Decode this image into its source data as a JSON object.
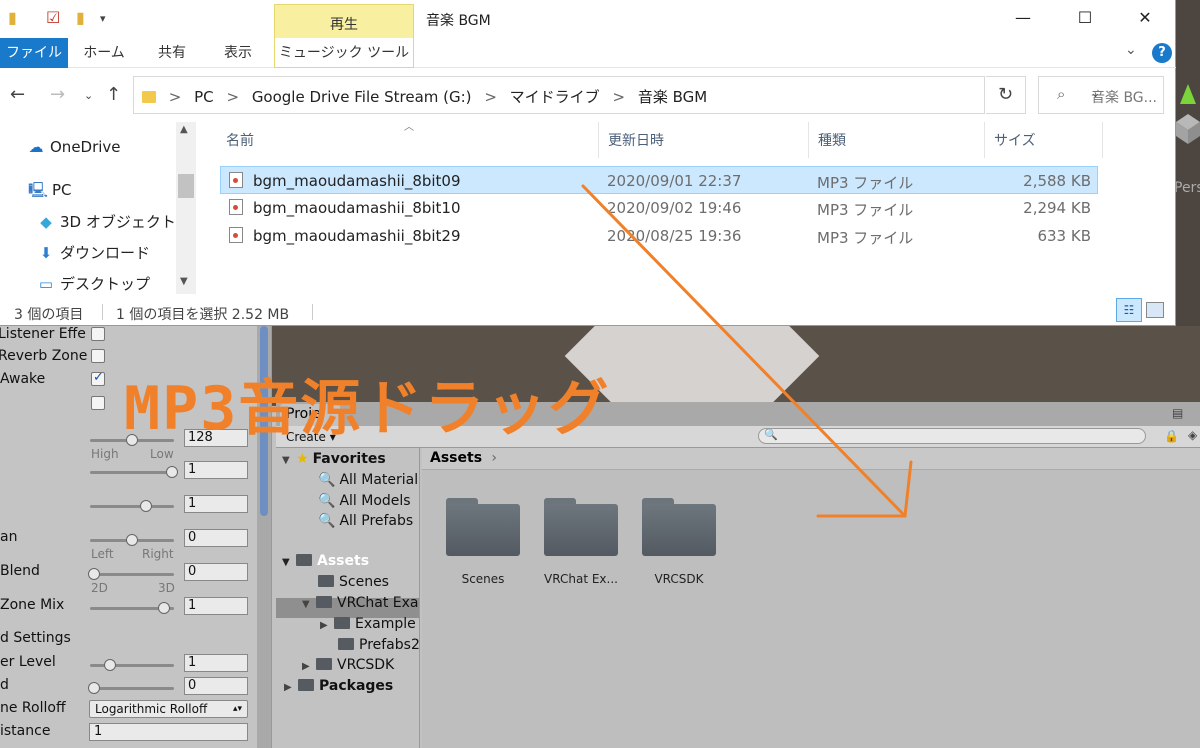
{
  "explorer": {
    "window_title": "音楽 BGM",
    "context_tab_group": "再生",
    "ribbon_tabs": {
      "file": "ファイル",
      "home": "ホーム",
      "share": "共有",
      "view": "表示",
      "music_tools": "ミュージック ツール"
    },
    "help": "?",
    "address": {
      "crumbs": [
        "PC",
        "Google Drive File Stream (G:)",
        "マイドライブ",
        "音楽 BGM"
      ],
      "separator": ">"
    },
    "search_placeholder": "音楽 BG...",
    "nav_pane": {
      "items": [
        {
          "label": "OneDrive",
          "icon": "onedrive-icon"
        },
        {
          "label": "PC",
          "icon": "pc-icon"
        },
        {
          "label": "3D オブジェクト",
          "icon": "3d-objects-icon"
        },
        {
          "label": "ダウンロード",
          "icon": "download-icon"
        },
        {
          "label": "デスクトップ",
          "icon": "desktop-icon"
        }
      ]
    },
    "columns": {
      "name": "名前",
      "modified": "更新日時",
      "type": "種類",
      "size": "サイズ"
    },
    "files": [
      {
        "name": "bgm_maoudamashii_8bit09",
        "modified": "2020/09/01 22:37",
        "type": "MP3 ファイル",
        "size": "2,588 KB",
        "selected": true
      },
      {
        "name": "bgm_maoudamashii_8bit10",
        "modified": "2020/09/02 19:46",
        "type": "MP3 ファイル",
        "size": "2,294 KB",
        "selected": false
      },
      {
        "name": "bgm_maoudamashii_8bit29",
        "modified": "2020/08/25 19:36",
        "type": "MP3 ファイル",
        "size": "633 KB",
        "selected": false
      }
    ],
    "status": {
      "item_count": "3 個の項目",
      "selection": "1 個の項目を選択  2.52 MB"
    }
  },
  "annotation": {
    "caption": "MP3音源ドラッグ",
    "color": "#f0812a"
  },
  "unity": {
    "scene_label": "Pers",
    "inspector": {
      "rows": {
        "listener_effects": "Listener Effe",
        "reverb_zone": "Reverb Zone",
        "play_awake": "Awake",
        "priority_value": "128",
        "priority_high": "High",
        "priority_low": "Low",
        "volume_value": "1",
        "pitch_value": "1",
        "pan_label": "an",
        "pan_value": "0",
        "pan_left": "Left",
        "pan_right": "Right",
        "spatial_label": "Blend",
        "spatial_value": "0",
        "spatial_2d": "2D",
        "spatial_3d": "3D",
        "reverb_mix_label": "Zone Mix",
        "reverb_mix_value": "1",
        "sound_settings": "d Settings",
        "doppler_label": "er Level",
        "doppler_value": "1",
        "spread_label": "d",
        "spread_value": "0",
        "rolloff_label": "ne Rolloff",
        "rolloff_value": "Logarithmic Rolloff",
        "min_distance_label": "istance",
        "min_distance_value": "1"
      }
    },
    "project": {
      "tab": "Proje",
      "create": "Create",
      "breadcrumb": "Assets",
      "tree": {
        "favorites": "Favorites",
        "all_materials": "All Material",
        "all_models": "All Models",
        "all_prefabs": "All Prefabs",
        "assets": "Assets",
        "scenes": "Scenes",
        "vrchat_examples": "VRChat Exa",
        "examples": "Example",
        "prefabs2": "Prefabs2",
        "vrcsdk": "VRCSDK",
        "packages": "Packages"
      },
      "assets": [
        "Scenes",
        "VRChat Ex...",
        "VRCSDK"
      ]
    }
  }
}
